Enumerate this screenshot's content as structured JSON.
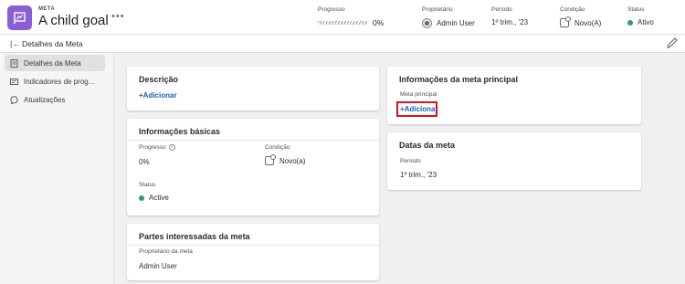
{
  "header": {
    "eyebrow": "META",
    "title": "A child goal",
    "more": "•••",
    "progress": {
      "label": "Progresso",
      "value": "0%"
    },
    "owner": {
      "label": "Proprietário",
      "value": "Admin User"
    },
    "period": {
      "label": "Período",
      "value": "1º trim., '23"
    },
    "condition": {
      "label": "Condição",
      "value": "Novo(A)"
    },
    "status": {
      "label": "Status",
      "value": "Ativo",
      "color": "#2d9d78"
    }
  },
  "subheader": {
    "title": "Detalhes da Meta"
  },
  "sidebar": {
    "items": [
      {
        "label": "Detalhes da Meta"
      },
      {
        "label": "Indicadores de prog..."
      },
      {
        "label": "Atualizações"
      }
    ]
  },
  "description": {
    "title": "Descrição",
    "add": "+Adicionar"
  },
  "basic_info": {
    "title": "Informações básicas",
    "progress_label": "Progresso",
    "progress_value": "0%",
    "condition_label": "Condição",
    "condition_value": "Novo(a)",
    "status_label": "Status",
    "status_value": "Active",
    "status_color": "#2d9d78"
  },
  "stakeholders": {
    "title": "Partes interessadas da meta",
    "owner_label": "Proprietário da meta",
    "owner_value": "Admin User"
  },
  "parent": {
    "title": "Informações da meta principal",
    "label": "Meta principal",
    "add": "+Adicionar"
  },
  "dates": {
    "title": "Datas da meta",
    "period_label": "Período",
    "period_value": "1º trim., '23"
  },
  "colors": {
    "accent": "#8a5fd6",
    "link": "#1d5ec2",
    "highlight": "#d7141a"
  }
}
